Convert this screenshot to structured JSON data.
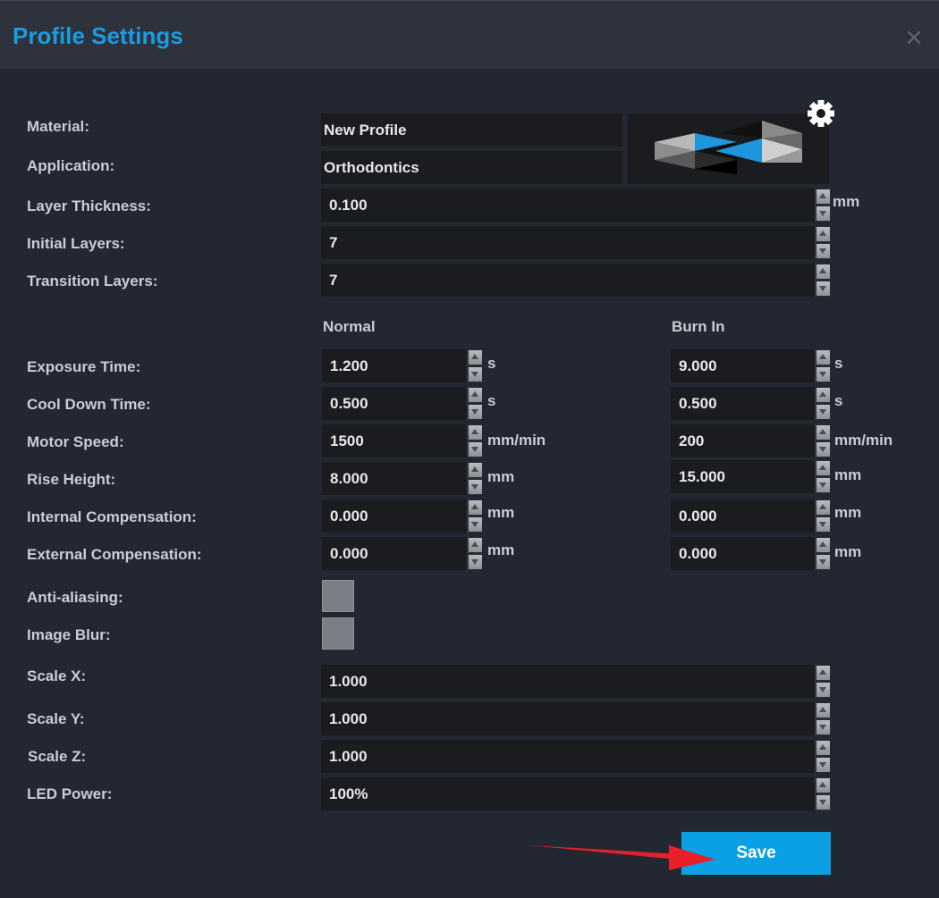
{
  "dialog": {
    "title": "Profile Settings",
    "close_icon": "close-icon"
  },
  "material": {
    "label": "Material:",
    "value": "New Profile"
  },
  "application": {
    "label": "Application:",
    "value": "Orthodontics"
  },
  "layer_thickness": {
    "label": "Layer Thickness:",
    "value": "0.100",
    "unit": "mm"
  },
  "initial_layers": {
    "label": "Initial Layers:",
    "value": "7"
  },
  "transition_layers": {
    "label": "Transition Layers:",
    "value": "7"
  },
  "columns": {
    "normal": "Normal",
    "burn_in": "Burn In"
  },
  "exposure_time": {
    "label": "Exposure Time:",
    "normal": "1.200",
    "burn_in": "9.000",
    "unit": "s"
  },
  "cool_down_time": {
    "label": "Cool Down Time:",
    "normal": "0.500",
    "burn_in": "0.500",
    "unit": "s"
  },
  "motor_speed": {
    "label": "Motor Speed:",
    "normal": "1500",
    "burn_in": "200",
    "unit": "mm/min"
  },
  "rise_height": {
    "label": "Rise Height:",
    "normal": "8.000",
    "burn_in": "15.000",
    "unit": "mm"
  },
  "internal_compensation": {
    "label": "Internal Compensation:",
    "normal": "0.000",
    "burn_in": "0.000",
    "unit": "mm"
  },
  "external_compensation": {
    "label": "External Compensation:",
    "normal": "0.000",
    "burn_in": "0.000",
    "unit": "mm"
  },
  "anti_aliasing": {
    "label": "Anti-aliasing:",
    "checked": false
  },
  "image_blur": {
    "label": "Image Blur:",
    "checked": false
  },
  "scale_x": {
    "label": "Scale X:",
    "value": "1.000"
  },
  "scale_y": {
    "label": "Scale Y:",
    "value": "1.000"
  },
  "scale_z": {
    "label": "Scale Z:",
    "value": "1.000"
  },
  "led_power": {
    "label": "LED Power:",
    "value": "100%"
  },
  "save": {
    "label": "Save"
  },
  "colors": {
    "accent": "#1d9be0",
    "save_button": "#0b9fe3",
    "arrow": "#e8202a",
    "background": "#232731",
    "field": "#1b1c1f"
  }
}
